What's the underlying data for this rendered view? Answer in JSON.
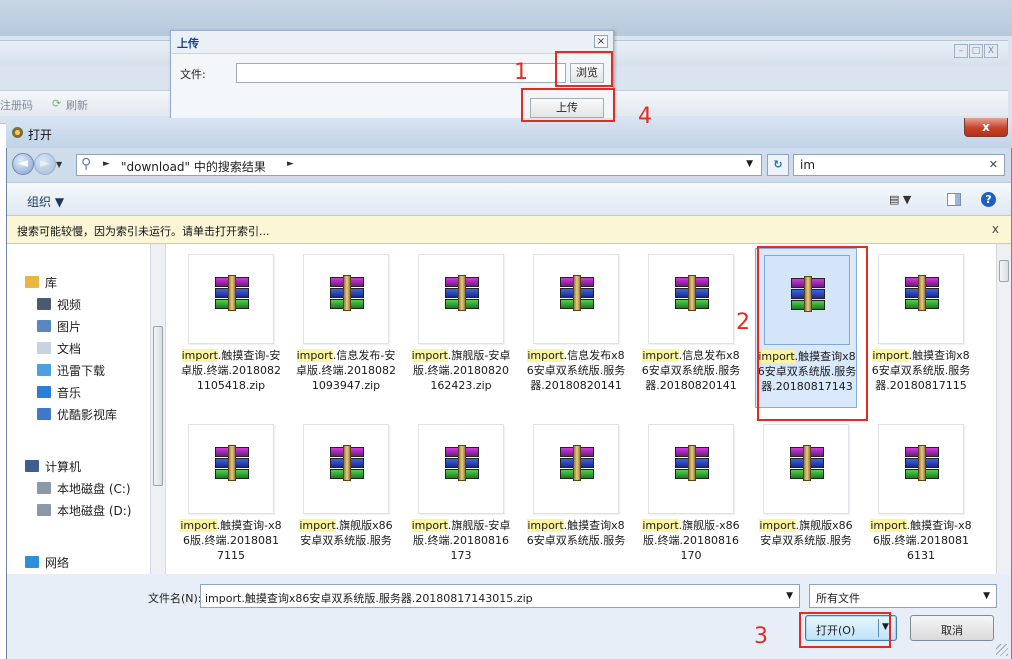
{
  "background_page": {
    "toolbar_items": [
      "注册码",
      "刷新"
    ],
    "window_buttons": [
      "–",
      "□",
      "X"
    ]
  },
  "upload_dialog": {
    "title": "上传",
    "close": "×",
    "file_label": "文件:",
    "file_value": "",
    "browse_label": "浏览",
    "upload_label": "上传"
  },
  "open_dialog": {
    "title": "打开",
    "close": "x",
    "address_path": "\"download\" 中的搜索结果",
    "search_value": "im",
    "organize_label": "组织 ▼",
    "info_bar": "搜索可能较慢，因为索引未运行。请单击打开索引...",
    "sidebar": {
      "groups": [
        {
          "label": "库",
          "icon": "library-icon",
          "items": [
            {
              "label": "视频",
              "icon": "video-icon"
            },
            {
              "label": "图片",
              "icon": "picture-icon"
            },
            {
              "label": "文档",
              "icon": "document-icon"
            },
            {
              "label": "迅雷下载",
              "icon": "download-icon"
            },
            {
              "label": "音乐",
              "icon": "music-icon"
            },
            {
              "label": "优酷影视库",
              "icon": "folder-icon"
            }
          ]
        },
        {
          "label": "计算机",
          "icon": "computer-icon",
          "items": [
            {
              "label": "本地磁盘 (C:)",
              "icon": "drive-icon"
            },
            {
              "label": "本地磁盘 (D:)",
              "icon": "drive-icon"
            }
          ]
        },
        {
          "label": "网络",
          "icon": "network-icon",
          "items": []
        }
      ]
    },
    "files": [
      {
        "hl": "import",
        "rest": ".触摸查询-安卓版.终端.20180821105418.zip"
      },
      {
        "hl": "import",
        "rest": ".信息发布-安卓版.终端.20180821093947.zip"
      },
      {
        "hl": "import",
        "rest": ".旗舰版-安卓版.终端.20180820162423.zip"
      },
      {
        "hl": "import",
        "rest": ".信息发布x86安卓双系统版.服务器.20180820141"
      },
      {
        "hl": "import",
        "rest": ".信息发布x86安卓双系统版.服务器.20180820141"
      },
      {
        "hl": "import",
        "rest": ".触摸查询x86安卓双系统版.服务器.20180817143",
        "selected": true
      },
      {
        "hl": "import",
        "rest": ".触摸查询x86安卓双系统版.服务器.20180817115"
      },
      {
        "hl": "import",
        "rest": ".触摸查询-x86版.终端.20180817115"
      },
      {
        "hl": "import",
        "rest": ".旗舰版x86安卓双系统版.服务"
      },
      {
        "hl": "import",
        "rest": ".旗舰版-安卓版.终端.20180816173"
      },
      {
        "hl": "import",
        "rest": ".触摸查询x86安卓双系统版.服务"
      },
      {
        "hl": "import",
        "rest": ".旗舰版-x86版.终端.20180816170"
      },
      {
        "hl": "import",
        "rest": ".旗舰版x86安卓双系统版.服务"
      },
      {
        "hl": "import",
        "rest": ".触摸查询-x86版.终端.20180816131"
      }
    ],
    "filename_label": "文件名(N):",
    "filename_value": "import.触摸查询x86安卓双系统版.服务器.20180817143015.zip",
    "filetype_value": "所有文件",
    "open_label": "打开(O)",
    "cancel_label": "取消"
  },
  "annotations": [
    "1",
    "2",
    "3",
    "4"
  ],
  "colors": {
    "annotation": "#e32b25",
    "highlight": "#fbf5a0",
    "selection": "#d9e8fb"
  }
}
